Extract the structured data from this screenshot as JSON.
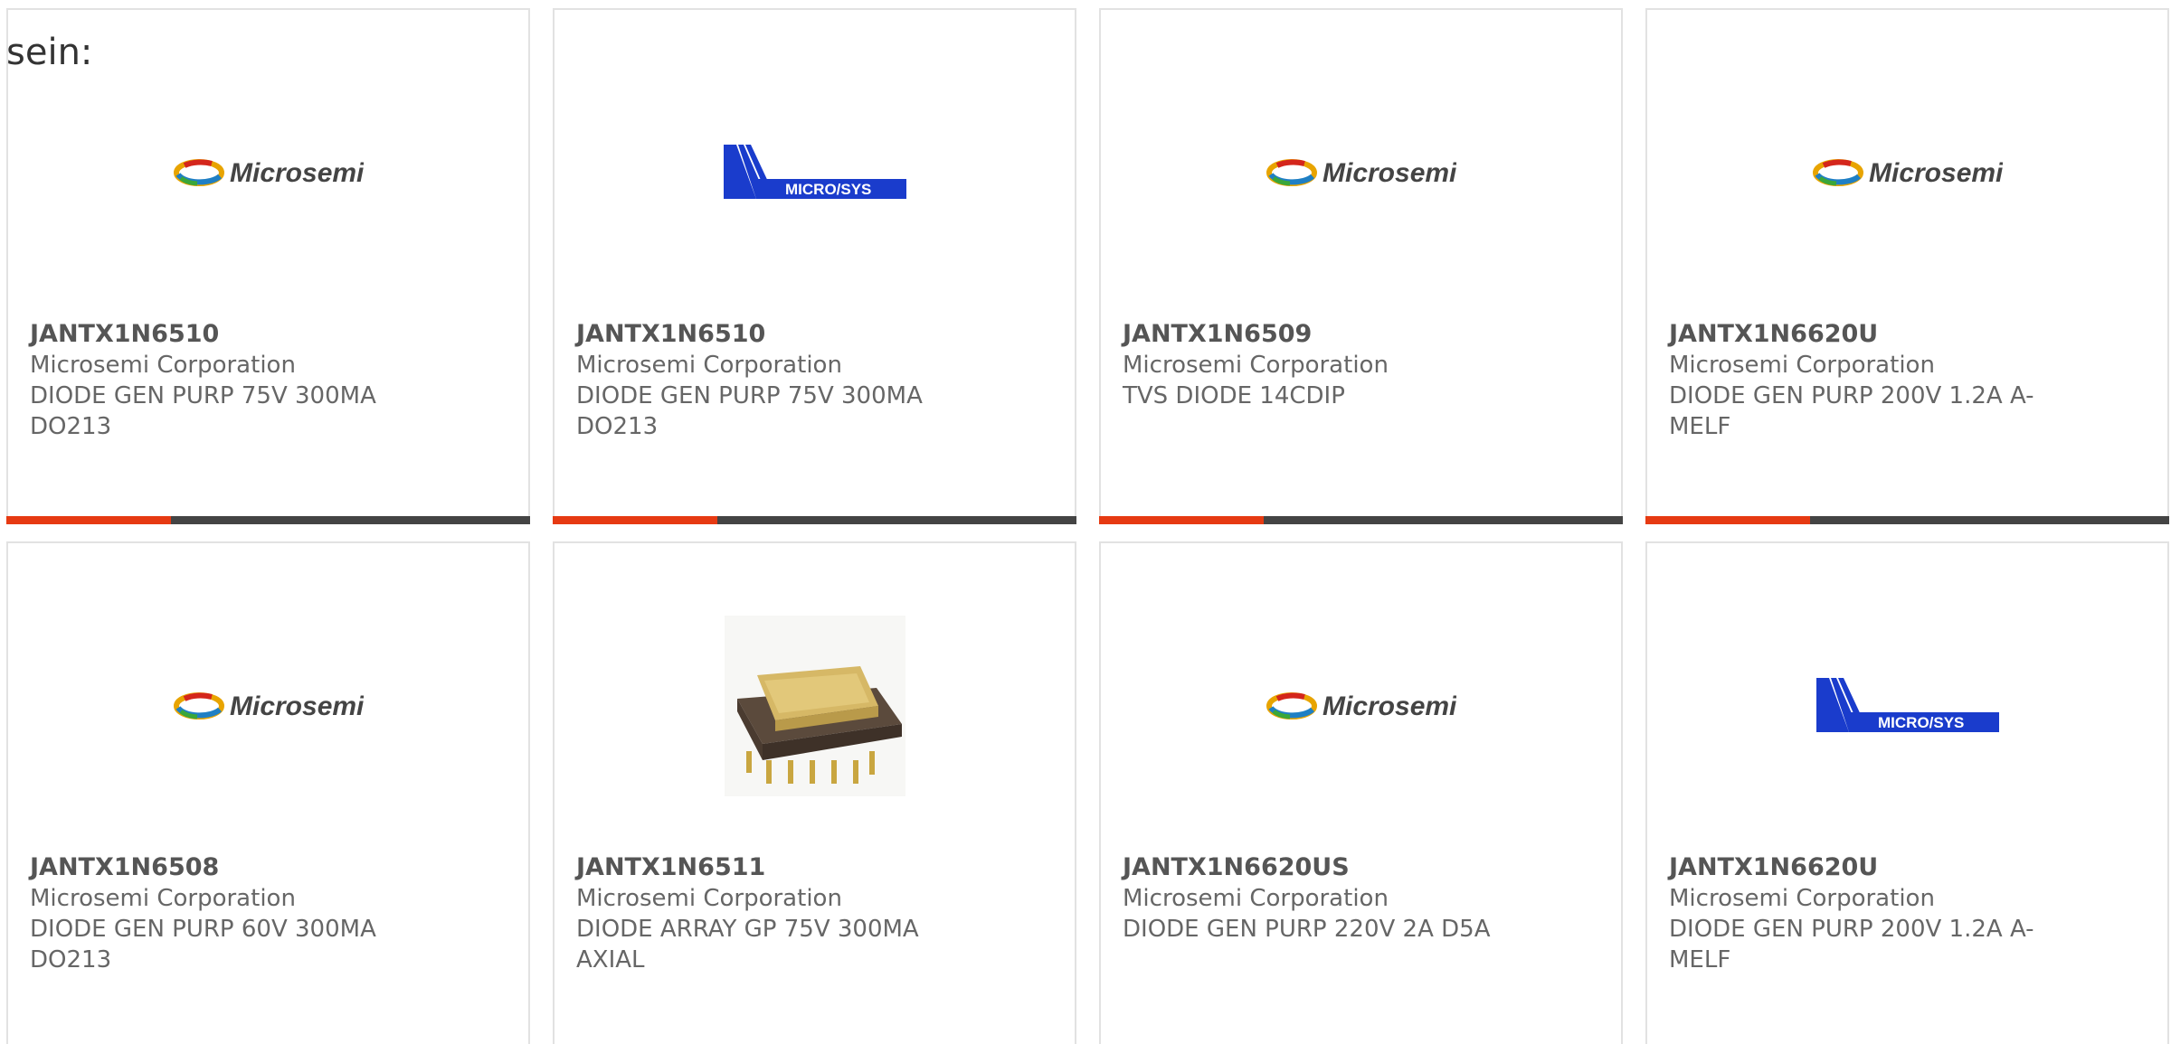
{
  "heading": "sein:",
  "colors": {
    "accent_bar": "#e63a12",
    "bar": "#444444",
    "card_border": "#e2e2e2"
  },
  "cards": [
    {
      "part_number": "JANTX1N6510",
      "manufacturer": "Microsemi Corporation",
      "description": "DIODE GEN PURP 75V 300MA DO213",
      "image": "microsemi-logo"
    },
    {
      "part_number": "JANTX1N6510",
      "manufacturer": "Microsemi Corporation",
      "description": "DIODE GEN PURP 75V 300MA DO213",
      "image": "microsys-logo",
      "logo_text": "MICRO/SYS"
    },
    {
      "part_number": "JANTX1N6509",
      "manufacturer": "Microsemi Corporation",
      "description": "TVS DIODE 14CDIP",
      "image": "microsemi-logo"
    },
    {
      "part_number": "JANTX1N6620U",
      "manufacturer": "Microsemi Corporation",
      "description": "DIODE GEN PURP 200V 1.2A A-MELF",
      "image": "microsemi-logo"
    },
    {
      "part_number": "JANTX1N6508",
      "manufacturer": "Microsemi Corporation",
      "description": "DIODE GEN PURP 60V 300MA DO213",
      "image": "microsemi-logo"
    },
    {
      "part_number": "JANTX1N6511",
      "manufacturer": "Microsemi Corporation",
      "description": "DIODE ARRAY GP 75V 300MA AXIAL",
      "image": "dip-chip-photo"
    },
    {
      "part_number": "JANTX1N6620US",
      "manufacturer": "Microsemi Corporation",
      "description": "DIODE GEN PURP 220V 2A D5A",
      "image": "microsemi-logo"
    },
    {
      "part_number": "JANTX1N6620U",
      "manufacturer": "Microsemi Corporation",
      "description": "DIODE GEN PURP 200V 1.2A A-MELF",
      "image": "microsys-logo",
      "logo_text": "MICRO/SYS"
    }
  ]
}
